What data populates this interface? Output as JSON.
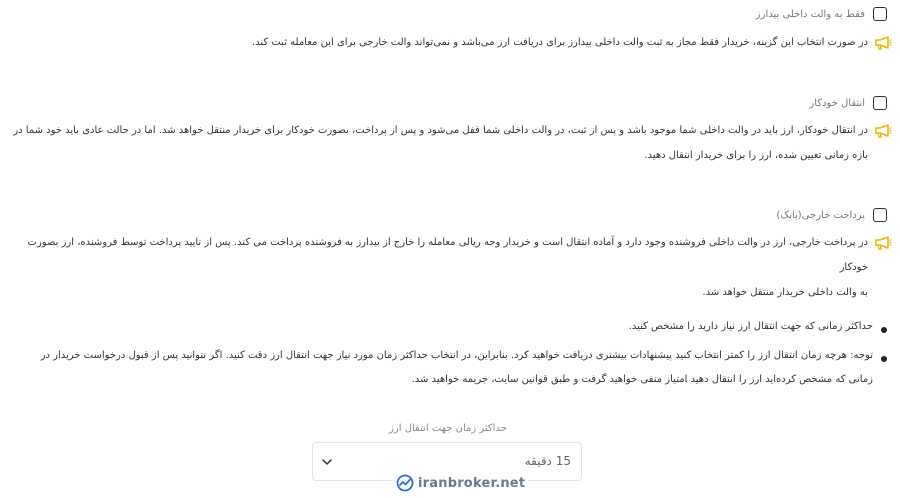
{
  "options": [
    {
      "label": "فقط به والت داخلی بیدارز",
      "desc": [
        "در صورت انتخاب این گزینه، خریدار فقط مجاز به ثبت والت داخلی بیدارز برای دریافت ارز می‌باشد و نمی‌تواند والت خارجی برای این معامله ثبت کند."
      ]
    },
    {
      "label": "انتقال خودکار",
      "desc": [
        "در انتقال خودکار، ارز باید در والت داخلی شما موجود باشد و پس از ثبت، در والت داخلی شما قفل می‌شود و پس از پرداخت، بصورت خودکار برای خریدار منتقل خواهد شد. اما در حالت عادی باید خود شما در",
        "بازه زمانی تعیین شده، ارز را برای خریدار انتقال دهید."
      ]
    },
    {
      "label": "پرداخت خارجی(بانک)",
      "desc": [
        "در پرداخت خارجی، ارز در والت داخلی فروشنده وجود دارد و آماده انتقال است و خریدار وجه ریالی معامله را خارج از بیدارز به فروشنده پرداخت می کند. پس از تایید پرداخت توسط فروشنده، ارز بصورت خودکار",
        "به والت داخلی خریدار منتقل خواهد شد."
      ]
    }
  ],
  "bullets": [
    [
      "حداکثر زمانی که جهت انتقال ارز نیاز دارید را مشخص کنید."
    ],
    [
      "توجه: هرچه زمان انتقال ارز را کمتر انتخاب کنید پیشنهادات بیشتری دریافت خواهید کرد. بنابراین، در انتخاب حداکثر زمان مورد نیاز جهت انتقال ارز دقت کنید. اگر نتوانید پس از قبول درخواست خریدار در",
      "زمانی که مشخص کرده‌اید ارز را انتقال دهید امتیاز منفی خواهید گرفت و طبق قوانین سایت، جریمه خواهید شد."
    ]
  ],
  "field": {
    "label": "حداکثر زمان جهت انتقال ارز",
    "value": "15 دقیقه"
  },
  "watermark": "iranbroker.net",
  "colors": {
    "accent": "#f0b400"
  }
}
